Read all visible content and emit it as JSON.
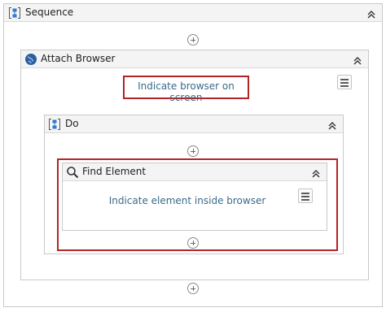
{
  "sequence": {
    "title": "Sequence"
  },
  "attach_browser": {
    "title": "Attach Browser",
    "indicate_label": "Indicate browser on screen"
  },
  "do": {
    "title": "Do"
  },
  "find_element": {
    "title": "Find Element",
    "indicate_label": "Indicate element inside browser"
  },
  "colors": {
    "highlight": "#b32427",
    "link": "#3a6a8a"
  },
  "icons": {
    "sequence": "sequence-icon",
    "attach_browser": "globe-icon",
    "do": "sequence-icon",
    "find_element": "magnifier-icon",
    "collapse": "double-chevron-up-icon",
    "add": "plus-circle-icon",
    "menu": "hamburger-menu-icon"
  }
}
